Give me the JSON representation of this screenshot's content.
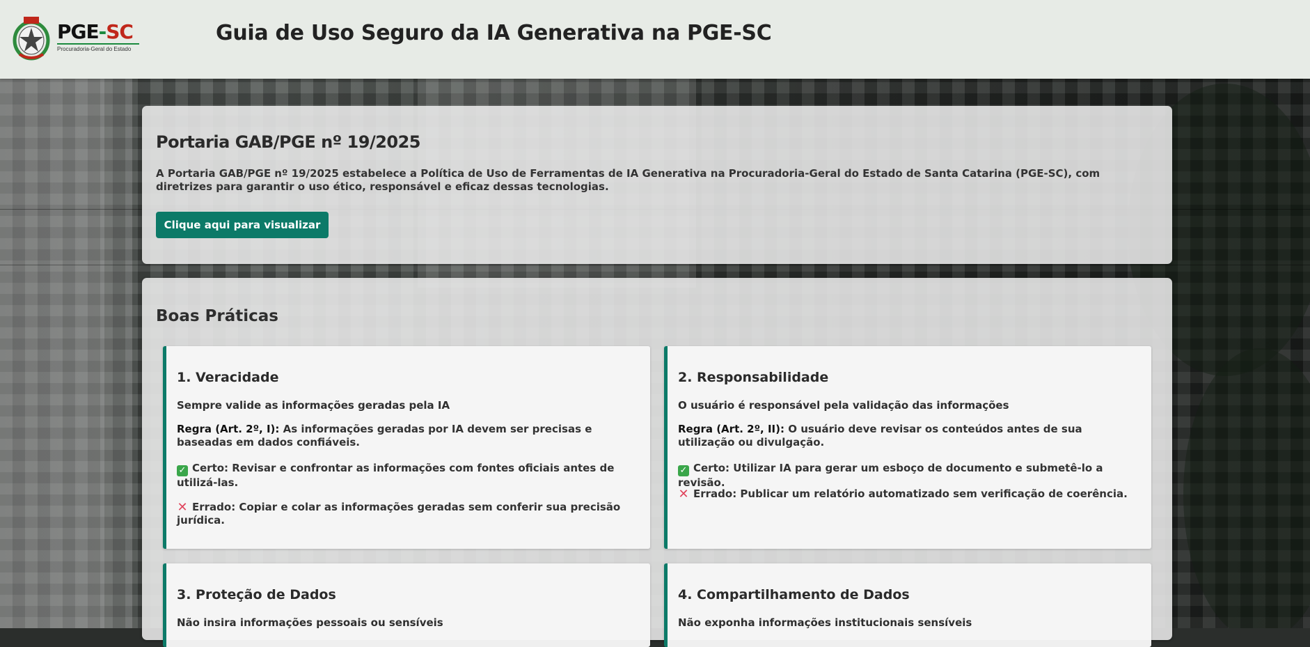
{
  "header": {
    "logo_main_pge": "PGE",
    "logo_main_dash": "-",
    "logo_main_sc": "SC",
    "logo_sub": "Procuradoria-Geral do Estado",
    "title": "Guia de Uso Seguro da IA Generativa na PGE-SC"
  },
  "portaria": {
    "title": "Portaria GAB/PGE nº 19/2025",
    "description": "A Portaria GAB/PGE nº 19/2025 estabelece a Política de Uso de Ferramentas de IA Generativa na Procuradoria-Geral do Estado de Santa Catarina (PGE-SC), com diretrizes para garantir o uso ético, responsável e eficaz dessas tecnologias.",
    "button_label": "Clique aqui para visualizar"
  },
  "boas_praticas": {
    "title": "Boas Práticas",
    "cards": [
      {
        "title": "1. Veracidade",
        "subtitle": "Sempre valide as informações geradas pela IA",
        "rule_label": "Regra (Art. 2º, I):",
        "rule_text": " As informações geradas por IA devem ser precisas e baseadas em dados confiáveis.",
        "ok": "Certo: Revisar e confrontar as informações com fontes oficiais antes de utilizá-las.",
        "bad": "Errado: Copiar e colar as informações geradas sem conferir sua precisão jurídica."
      },
      {
        "title": "2. Responsabilidade",
        "subtitle": "O usuário é responsável pela validação das informações",
        "rule_label": "Regra (Art. 2º, II):",
        "rule_text": " O usuário deve revisar os conteúdos antes de sua utilização ou divulgação.",
        "ok": "Certo: Utilizar IA para gerar um esboço de documento e submetê-lo a revisão.",
        "bad": "Errado: Publicar um relatório automatizado sem verificação de coerência."
      },
      {
        "title": "3. Proteção de Dados",
        "subtitle": "Não insira informações pessoais ou sensíveis"
      },
      {
        "title": "4. Compartilhamento de Dados",
        "subtitle": "Não exponha informações institucionais sensíveis"
      }
    ]
  },
  "icons": {
    "ok": "check-icon",
    "bad": "cross-icon"
  },
  "colors": {
    "accent": "#0c7a68",
    "header_bg": "#e7ebe6",
    "logo_red": "#c0271b",
    "logo_green": "#1a8a3e"
  }
}
